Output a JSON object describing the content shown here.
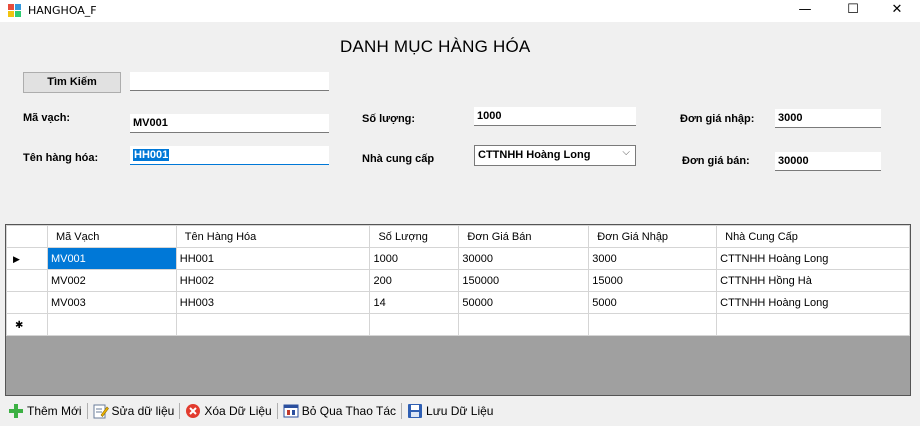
{
  "window": {
    "title": "HANGHOA_F",
    "minimize_glyph": "—",
    "maximize_glyph": "☐",
    "close_glyph": "✕"
  },
  "form": {
    "heading": "DANH MỤC HÀNG HÓA",
    "search_button": "Tìm Kiếm",
    "search_value": "",
    "barcode_label": "Mã vạch:",
    "barcode_value": "MV001",
    "name_label": "Tên hàng hóa:",
    "name_value": "HH001",
    "qty_label": "Số lượng:",
    "qty_value": "1000",
    "supplier_label": "Nhà cung cấp",
    "supplier_value": "CTTNHH Hoàng Long",
    "buy_price_label": "Đơn giá nhập:",
    "buy_price_value": "3000",
    "sell_price_label": "Đơn giá bán:",
    "sell_price_value": "30000"
  },
  "grid": {
    "columns": [
      "Mã Vạch",
      "Tên Hàng Hóa",
      "Số Lượng",
      "Đơn Giá Bán",
      "Đơn Giá Nhập",
      "Nhà Cung Cấp"
    ],
    "rows": [
      [
        "MV001",
        "HH001",
        "1000",
        "30000",
        "3000",
        "CTTNHH Hoàng Long"
      ],
      [
        "MV002",
        "HH002",
        "200",
        "150000",
        "15000",
        "CTTNHH Hồng Hà"
      ],
      [
        "MV003",
        "HH003",
        "14",
        "50000",
        "5000",
        "CTTNHH Hoàng Long"
      ]
    ],
    "current_row_marker": "▶",
    "new_row_marker": "✱"
  },
  "toolbar": {
    "items": [
      {
        "label": "Thêm Mới",
        "icon": "add-icon"
      },
      {
        "label": "Sửa dữ liệu",
        "icon": "edit-icon"
      },
      {
        "label": "Xóa Dữ Liệu",
        "icon": "delete-icon"
      },
      {
        "label": "Bỏ Qua Thao Tác",
        "icon": "skip-icon"
      },
      {
        "label": "Lưu Dữ Liệu",
        "icon": "save-icon"
      }
    ]
  }
}
